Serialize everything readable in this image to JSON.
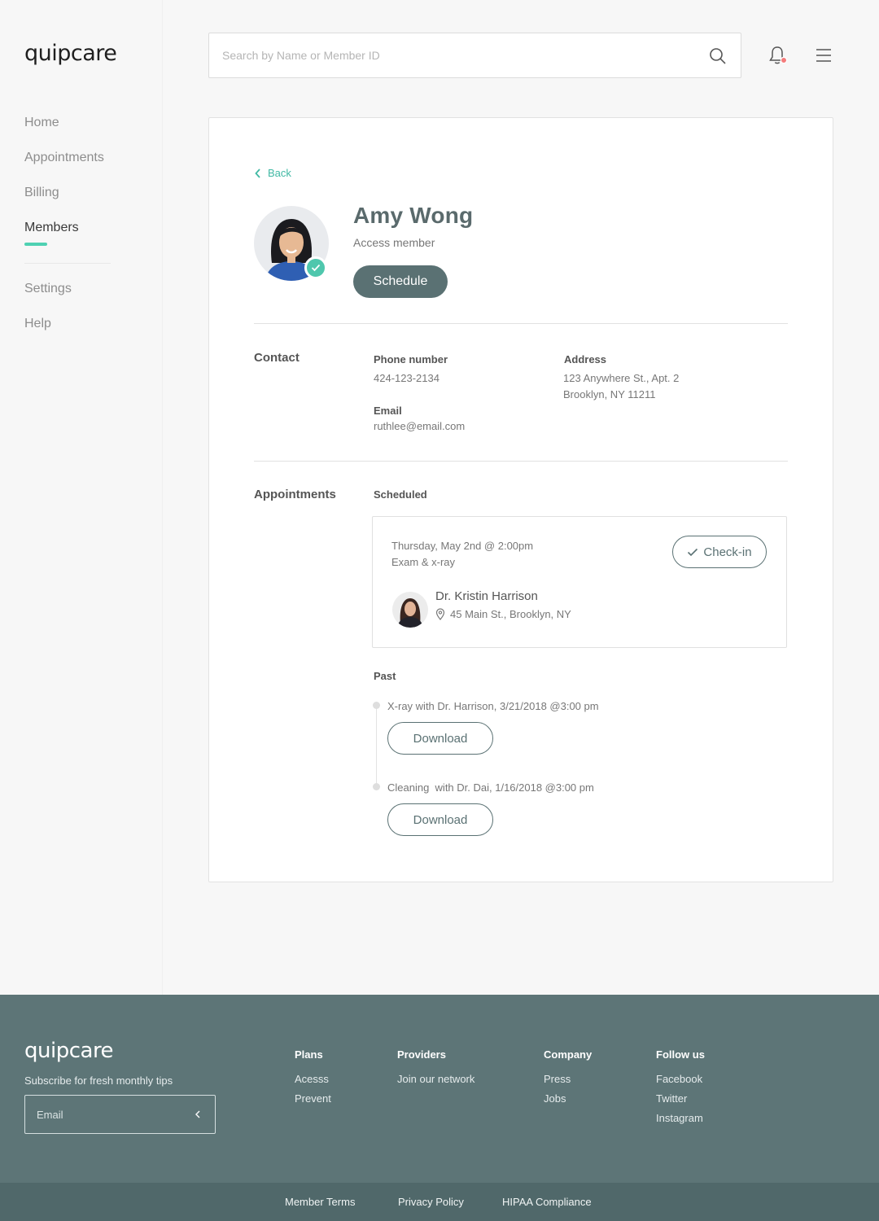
{
  "brand": {
    "logo": "quipcare",
    "accent": "#4fd1b2",
    "primary": "#5a7173"
  },
  "sidebar": {
    "items": [
      {
        "label": "Home"
      },
      {
        "label": "Appointments"
      },
      {
        "label": "Billing"
      },
      {
        "label": "Members",
        "active": true
      }
    ],
    "secondary": [
      {
        "label": "Settings"
      },
      {
        "label": "Help"
      }
    ]
  },
  "header": {
    "search": {
      "placeholder": "Search by Name or Member ID",
      "value": ""
    },
    "icons": [
      "search-icon",
      "bell-icon",
      "hamburger-menu-icon"
    ],
    "notification_dot_color": "#f47c7c"
  },
  "profile": {
    "back_label": "Back",
    "name": "Amy Wong",
    "member_type": "Access member",
    "schedule_label": "Schedule"
  },
  "contact": {
    "section_label": "Contact",
    "phone_label": "Phone number",
    "phone": "424-123-2134",
    "email_label": "Email",
    "email": "ruthlee@email.com",
    "address_label": "Address",
    "address_line1": "123 Anywhere St., Apt. 2",
    "address_line2": "Brooklyn, NY 11211"
  },
  "appointments": {
    "section_label": "Appointments",
    "scheduled_label": "Scheduled",
    "scheduled": {
      "date": "Thursday, May 2nd @ 2:00pm",
      "type": "Exam & x-ray",
      "checkin_label": "Check-in",
      "doctor": "Dr. Kristin Harrison",
      "location": "45 Main St., Brooklyn, NY"
    },
    "past_label": "Past",
    "past": [
      {
        "text": "X-ray with Dr. Harrison, 3/21/2018 @3:00 pm",
        "button": "Download"
      },
      {
        "text": "Cleaning  with Dr. Dai, 1/16/2018 @3:00 pm",
        "button": "Download"
      }
    ]
  },
  "footer": {
    "logo": "quipcare",
    "subscribe_text": "Subscribe for fresh monthly tips",
    "email_placeholder": "Email",
    "columns": [
      {
        "title": "Plans",
        "links": [
          "Acesss",
          "Prevent"
        ]
      },
      {
        "title": "Providers",
        "links": [
          "Join our network"
        ]
      },
      {
        "title": "Company",
        "links": [
          "Press",
          "Jobs"
        ]
      },
      {
        "title": "Follow us",
        "links": [
          "Facebook",
          "Twitter",
          "Instagram"
        ]
      }
    ],
    "bottom_links": [
      "Member Terms",
      "Privacy Policy",
      "HIPAA Compliance"
    ]
  }
}
